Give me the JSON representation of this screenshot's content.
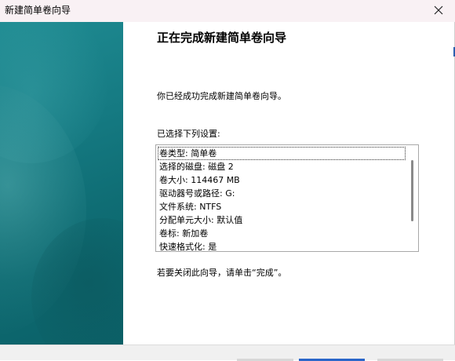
{
  "window": {
    "title": "新建简单卷向导"
  },
  "page": {
    "heading": "正在完成新建简单卷向导",
    "intro": "你已经成功完成新建简单卷向导。",
    "settings_label": "已选择下列设置:",
    "settings": [
      "卷类型: 简单卷",
      "选择的磁盘: 磁盘 2",
      "卷大小: 114467 MB",
      "驱动器号或路径: G:",
      "文件系统: NTFS",
      "分配单元大小: 默认值",
      "卷标: 新加卷",
      "快速格式化: 是"
    ],
    "finish_hint": "若要关闭此向导，请单击“完成”。"
  },
  "icons": {
    "close": "close-icon"
  },
  "colors": {
    "banner": "#157a82",
    "titlebar": "#f9f1f4",
    "primary_button": "#2a66c9"
  }
}
